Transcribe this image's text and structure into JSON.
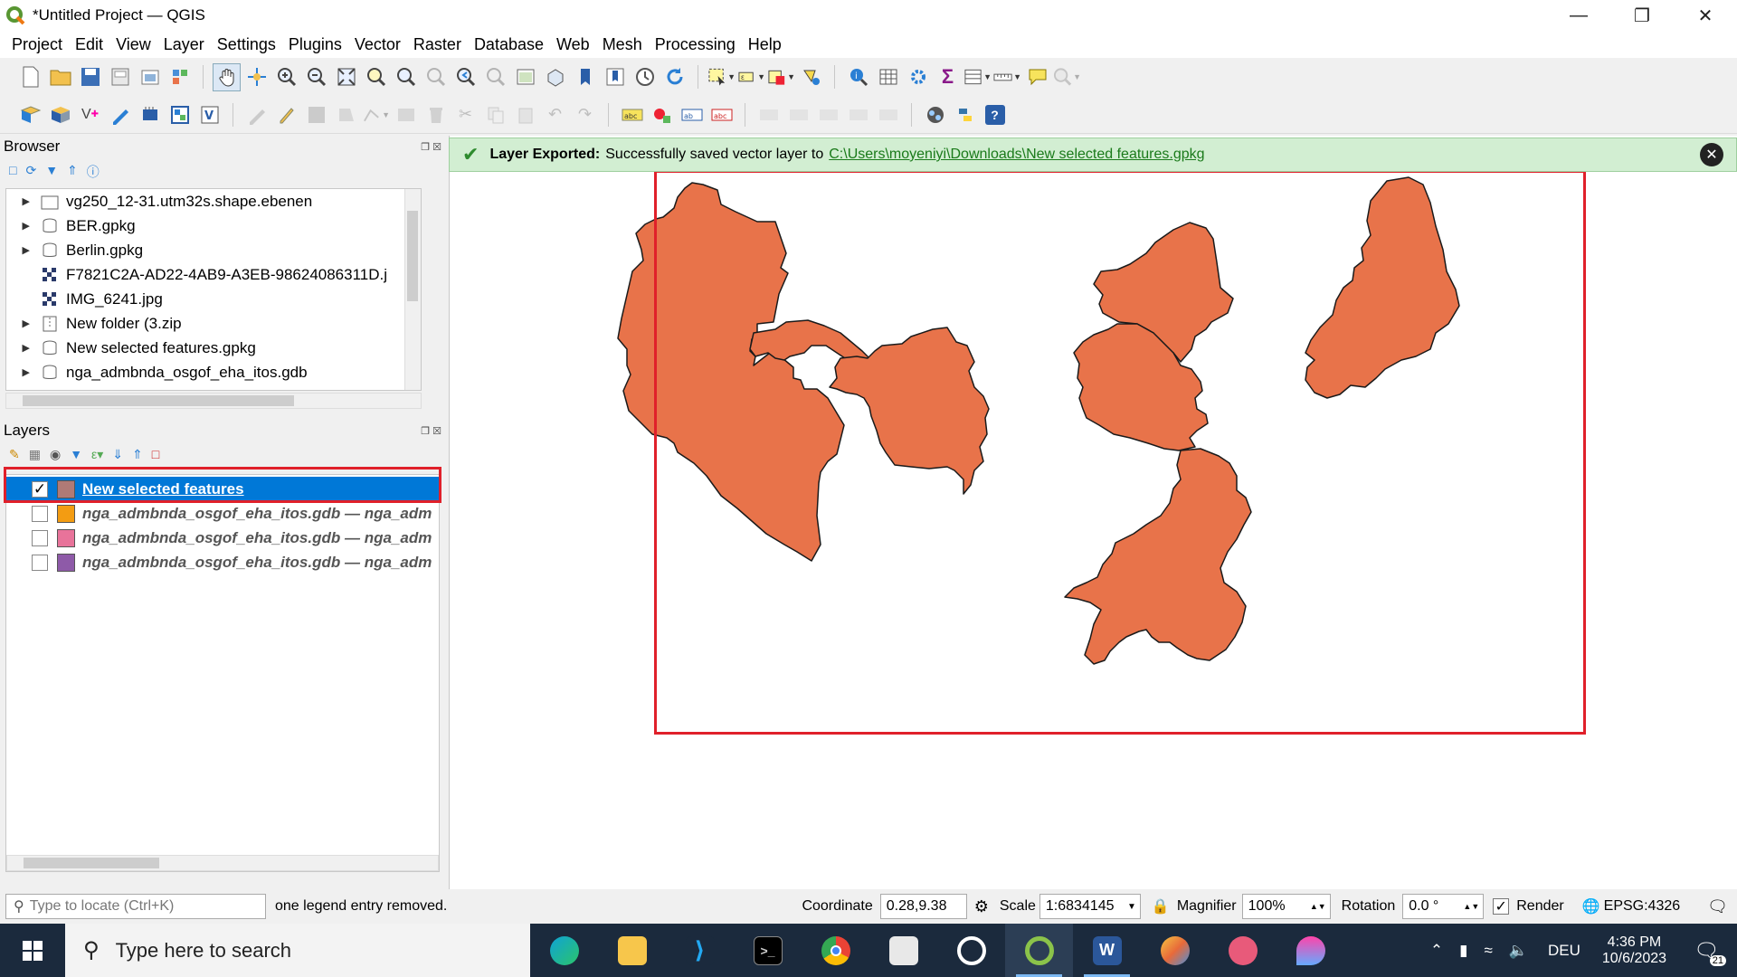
{
  "window": {
    "title": "*Untitled Project — QGIS",
    "controls": [
      "minimize",
      "restore",
      "close"
    ]
  },
  "menubar": [
    "Project",
    "Edit",
    "View",
    "Layer",
    "Settings",
    "Plugins",
    "Vector",
    "Raster",
    "Database",
    "Web",
    "Mesh",
    "Processing",
    "Help"
  ],
  "browser": {
    "title": "Browser",
    "items": [
      {
        "label": "vg250_12-31.utm32s.shape.ebenen",
        "icon": "folder-icon",
        "expandable": true
      },
      {
        "label": "BER.gpkg",
        "icon": "database-icon",
        "expandable": true
      },
      {
        "label": "Berlin.gpkg",
        "icon": "database-icon",
        "expandable": true
      },
      {
        "label": "F7821C2A-AD22-4AB9-A3EB-98624086311D.j",
        "icon": "raster-icon",
        "expandable": false
      },
      {
        "label": "IMG_6241.jpg",
        "icon": "raster-icon",
        "expandable": false
      },
      {
        "label": "New folder (3.zip",
        "icon": "zip-icon",
        "expandable": true
      },
      {
        "label": "New selected features.gpkg",
        "icon": "database-icon",
        "expandable": true
      },
      {
        "label": "nga_admbnda_osgof_eha_itos.gdb",
        "icon": "database-icon",
        "expandable": true
      }
    ]
  },
  "layers": {
    "title": "Layers",
    "items": [
      {
        "label": "New selected features",
        "checked": true,
        "color": "#b07a76",
        "selected": true
      },
      {
        "label": "nga_admbnda_osgof_eha_itos.gdb — nga_adm",
        "checked": false,
        "color": "#f39c12",
        "selected": false
      },
      {
        "label": "nga_admbnda_osgof_eha_itos.gdb — nga_adm",
        "checked": false,
        "color": "#e8739a",
        "selected": false
      },
      {
        "label": "nga_admbnda_osgof_eha_itos.gdb — nga_adm",
        "checked": false,
        "color": "#8e5aa8",
        "selected": false
      }
    ]
  },
  "message": {
    "bold": "Layer Exported:",
    "text": "Successfully saved vector layer to",
    "link": "C:\\Users\\moyeniyi\\Downloads\\New selected features.gpkg"
  },
  "map": {
    "fill_color": "#e8734a",
    "stroke_color": "#1a1a1a",
    "highlight_color": "#e0202a"
  },
  "statusbar": {
    "locate_placeholder": "Type to locate (Ctrl+K)",
    "status_message": "one legend entry removed.",
    "coordinate_label": "Coordinate",
    "coordinate_value": "0.28,9.38",
    "scale_label": "Scale",
    "scale_value": "1:6834145",
    "magnifier_label": "Magnifier",
    "magnifier_value": "100%",
    "rotation_label": "Rotation",
    "rotation_value": "0.0 °",
    "render_label": "Render",
    "crs": "EPSG:4326"
  },
  "taskbar": {
    "search_placeholder": "Type here to search",
    "apps": [
      "edge-icon",
      "file-explorer-icon",
      "vscode-icon",
      "terminal-icon",
      "chrome-icon",
      "notepad-icon",
      "ccleaner-icon",
      "qgis-icon",
      "word-icon",
      "paint-icon",
      "snipping-icon",
      "paint3d-icon"
    ],
    "language": "DEU",
    "time": "4:36 PM",
    "date": "10/6/2023",
    "notification_count": "21"
  }
}
